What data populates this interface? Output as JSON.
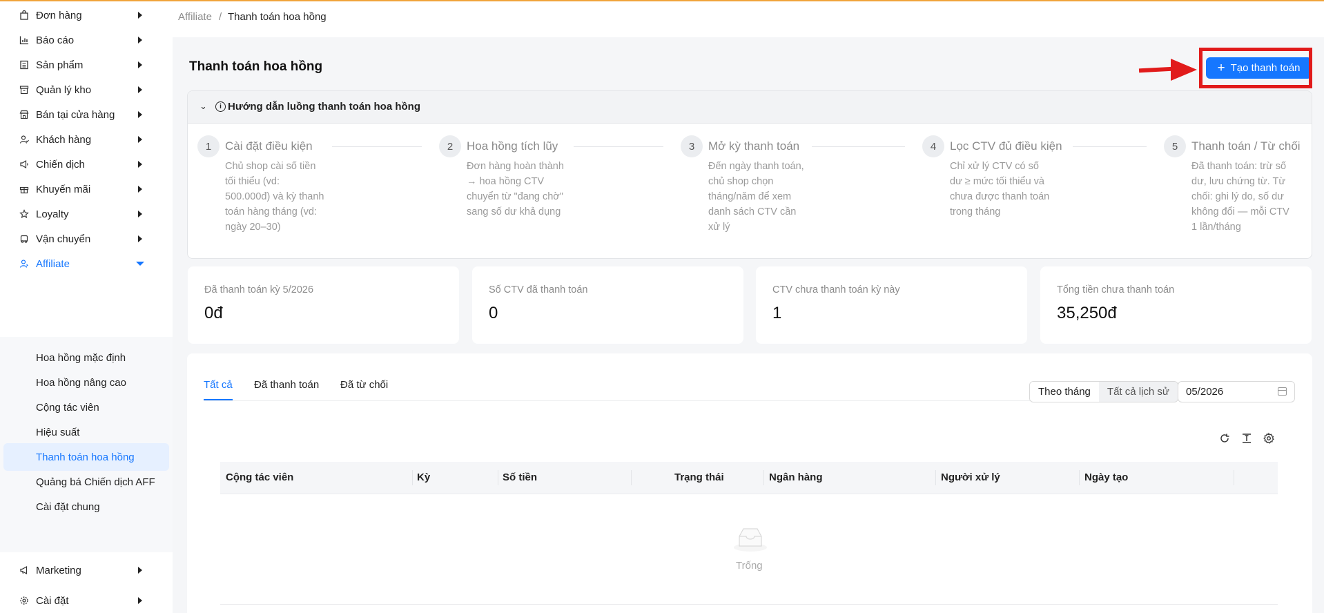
{
  "sidebar": {
    "items": [
      {
        "label": "Đơn hàng",
        "icon": "shopping-bag-icon"
      },
      {
        "label": "Báo cáo",
        "icon": "bar-chart-icon"
      },
      {
        "label": "Sản phẩm",
        "icon": "product-list-icon"
      },
      {
        "label": "Quản lý kho",
        "icon": "warehouse-icon"
      },
      {
        "label": "Bán tại cửa hàng",
        "icon": "store-icon"
      },
      {
        "label": "Khách hàng",
        "icon": "customer-icon"
      },
      {
        "label": "Chiến dịch",
        "icon": "megaphone-icon"
      },
      {
        "label": "Khuyến mãi",
        "icon": "gift-icon"
      },
      {
        "label": "Loyalty",
        "icon": "star-icon"
      },
      {
        "label": "Vận chuyển",
        "icon": "truck-icon"
      },
      {
        "label": "Affiliate",
        "icon": "affiliate-icon"
      },
      {
        "label": "Marketing",
        "icon": "notification-icon"
      },
      {
        "label": "Cài đặt",
        "icon": "settings-icon"
      }
    ],
    "affiliate_submenu": [
      "Hoa hồng mặc định",
      "Hoa hồng nâng cao",
      "Cộng tác viên",
      "Hiệu suất",
      "Thanh toán hoa hồng",
      "Quảng bá Chiến dịch AFF",
      "Cài đặt chung"
    ]
  },
  "breadcrumb": {
    "root": "Affiliate",
    "separator": "/",
    "current": "Thanh toán hoa hồng"
  },
  "page": {
    "title": "Thanh toán hoa hồng",
    "create_button": "Tạo thanh toán"
  },
  "guide": {
    "title": "Hướng dẫn luồng thanh toán hoa hồng",
    "steps": [
      {
        "num": "1",
        "title": "Cài đặt điều kiện",
        "desc": "Chủ shop cài số tiền tối thiểu (vd: 500.000đ) và kỳ thanh toán hàng tháng (vd: ngày 20–30)"
      },
      {
        "num": "2",
        "title": "Hoa hồng tích lũy",
        "desc": "Đơn hàng hoàn thành → hoa hồng CTV chuyển từ \"đang chờ\" sang số dư khả dụng"
      },
      {
        "num": "3",
        "title": "Mở kỳ thanh toán",
        "desc": "Đến ngày thanh toán, chủ shop chọn tháng/năm để xem danh sách CTV cần xử lý"
      },
      {
        "num": "4",
        "title": "Lọc CTV đủ điều kiện",
        "desc": "Chỉ xử lý CTV có số dư ≥ mức tối thiểu và chưa được thanh toán trong tháng"
      },
      {
        "num": "5",
        "title": "Thanh toán / Từ chối",
        "desc": "Đã thanh toán: trừ số dư, lưu chứng từ. Từ chối: ghi lý do, số dư không đổi — mỗi CTV 1 lần/tháng"
      }
    ]
  },
  "stats": [
    {
      "label": "Đã thanh toán kỳ 5/2026",
      "value": "0đ"
    },
    {
      "label": "Số CTV đã thanh toán",
      "value": "0"
    },
    {
      "label": "CTV chưa thanh toán kỳ này",
      "value": "1"
    },
    {
      "label": "Tổng tiền chưa thanh toán",
      "value": "35,250đ"
    }
  ],
  "tabs": [
    "Tất cả",
    "Đã thanh toán",
    "Đã từ chối"
  ],
  "filter": {
    "by_month": "Theo tháng",
    "all_history": "Tất cả lịch sử",
    "month_value": "05/2026"
  },
  "table": {
    "columns": [
      "Cộng tác viên",
      "Kỳ",
      "Số tiền",
      "Trạng thái",
      "Ngân hàng",
      "Người xử lý",
      "Ngày tạo"
    ],
    "empty_text": "Trống"
  },
  "colors": {
    "accent": "#1677ff",
    "annotation": "#e11b1b",
    "top_bar": "#f0a43c"
  }
}
